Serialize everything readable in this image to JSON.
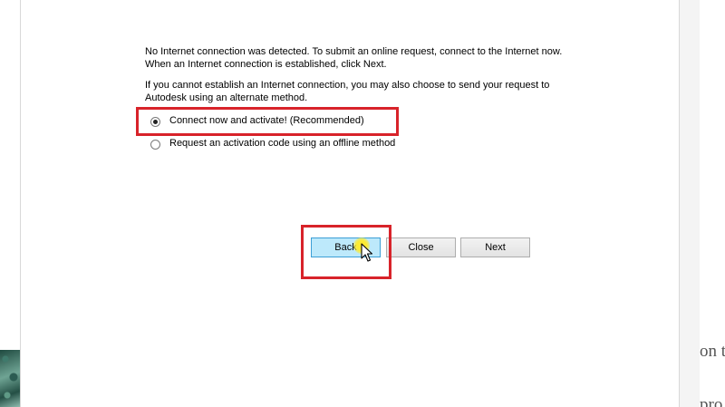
{
  "dialog": {
    "message_paragraph_1": [
      "No Internet connection was detected. To submit an online request, connect to the Internet now.",
      "When an Internet connection is established, click Next."
    ],
    "message_paragraph_2": [
      "If you cannot establish an Internet connection, you may also choose to send your request to",
      "Autodesk using an alternate method."
    ],
    "options": [
      {
        "label": "Connect now and activate! (Recommended)",
        "selected": true
      },
      {
        "label": "Request an activation code using an offline method",
        "selected": false
      }
    ],
    "buttons": {
      "back": "Back",
      "close": "Close",
      "next": "Next"
    }
  },
  "background": {
    "text_fragment_1": "on t",
    "text_fragment_2": "pro"
  },
  "colors": {
    "highlight": "#d8232a",
    "back_button_fill": "#bde9fb",
    "back_button_border": "#3c9fd6",
    "cursor_glow": "#ffeb28"
  },
  "icons": {
    "cursor": "mouse-pointer-icon",
    "radio_selected": "radio-selected-icon",
    "radio_unselected": "radio-unselected-icon"
  }
}
